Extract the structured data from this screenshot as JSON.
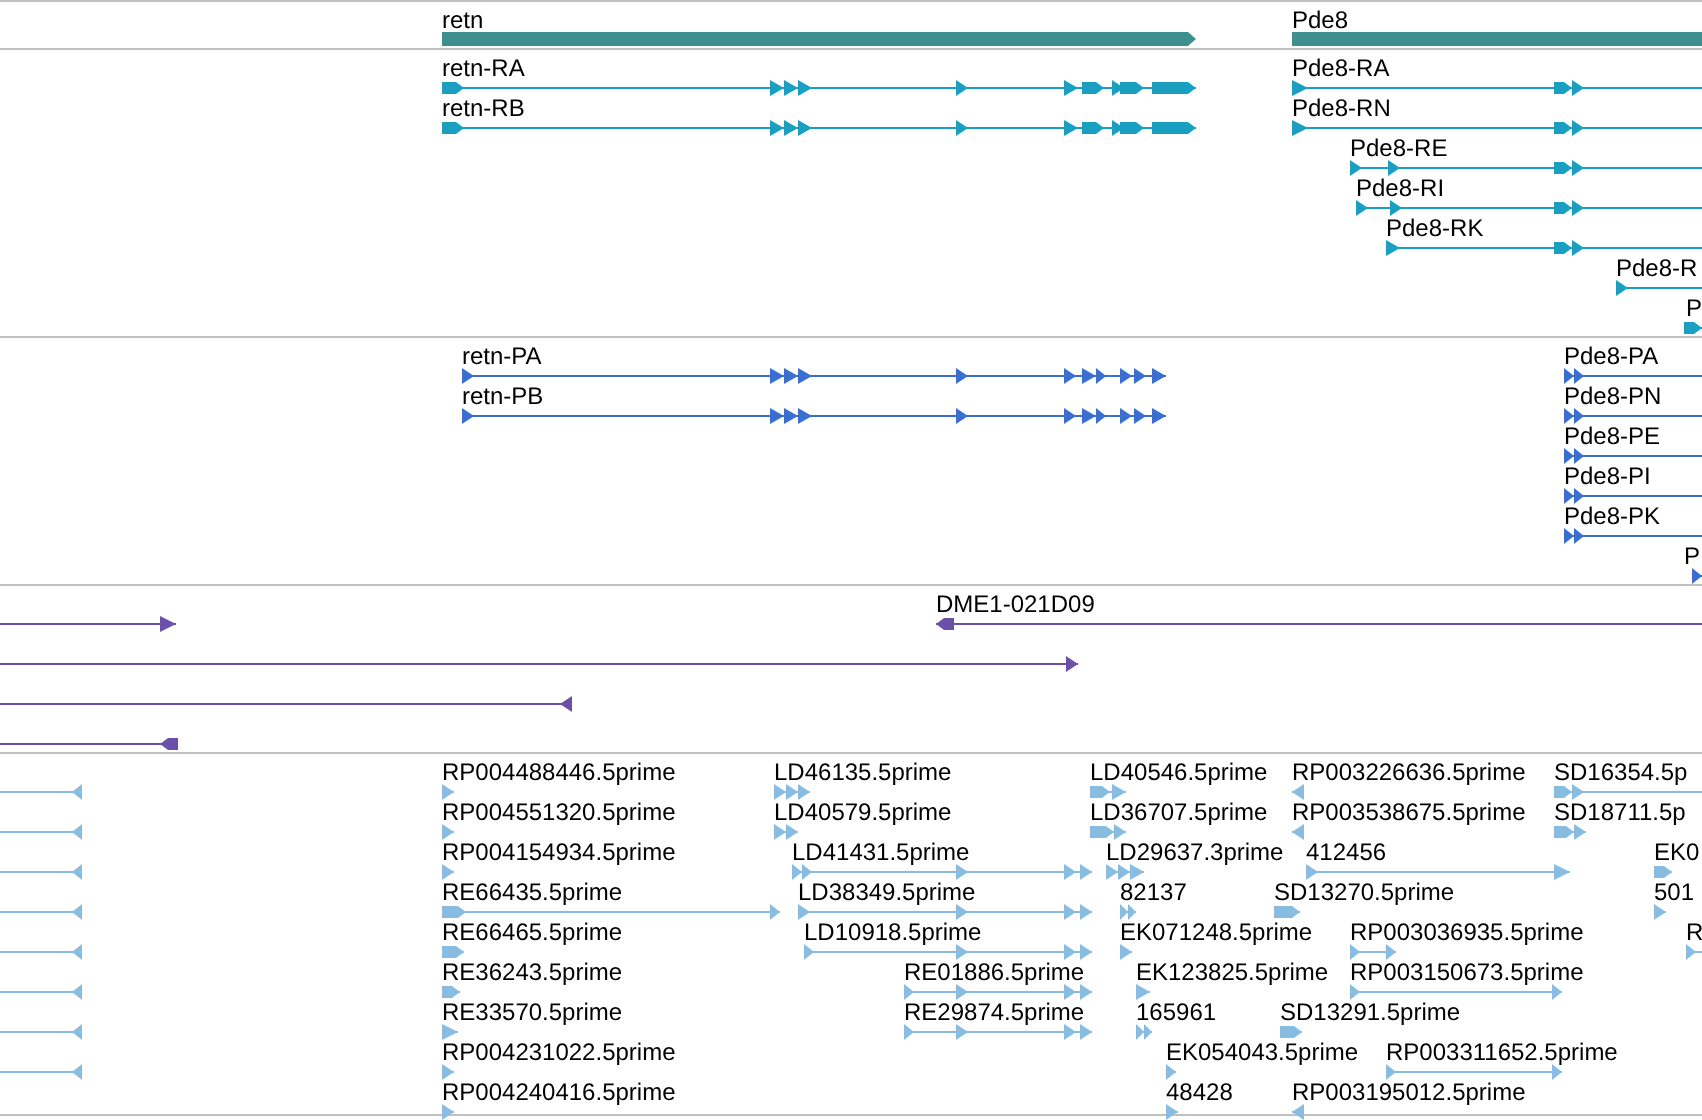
{
  "tracks": [
    {
      "kind": "gene",
      "color": "#3f8f8f",
      "features": [
        {
          "label": "retn",
          "reverse": false
        },
        {
          "label": "Pde8",
          "reverse": false
        }
      ]
    },
    {
      "kind": "transcript",
      "color": "#1a9fc0",
      "features": [
        {
          "label": "retn-RA",
          "reverse": false
        },
        {
          "label": "retn-RB",
          "reverse": false
        },
        {
          "label": "Pde8-RA",
          "reverse": false
        },
        {
          "label": "Pde8-RN",
          "reverse": false
        },
        {
          "label": "Pde8-RE",
          "reverse": false
        },
        {
          "label": "Pde8-RI",
          "reverse": false
        },
        {
          "label": "Pde8-RK",
          "reverse": false
        },
        {
          "label": "Pde8-R",
          "reverse": false
        },
        {
          "label": "P",
          "reverse": false
        }
      ]
    },
    {
      "kind": "protein",
      "color": "#3a6fd0",
      "features": [
        {
          "label": "retn-PA",
          "reverse": false
        },
        {
          "label": "retn-PB",
          "reverse": false
        },
        {
          "label": "Pde8-PA",
          "reverse": false
        },
        {
          "label": "Pde8-PN",
          "reverse": false
        },
        {
          "label": "Pde8-PE",
          "reverse": false
        },
        {
          "label": "Pde8-PI",
          "reverse": false
        },
        {
          "label": "Pde8-PK",
          "reverse": false
        },
        {
          "label": "P",
          "reverse": false
        }
      ]
    },
    {
      "kind": "clone",
      "color": "#6a50a8",
      "features": [
        {
          "reverse": false
        },
        {
          "label": "DME1-021D09",
          "reverse": true
        },
        {
          "reverse": false
        },
        {
          "reverse": true
        },
        {
          "reverse": true
        }
      ]
    },
    {
      "kind": "est",
      "color": "#88bce0",
      "features": [
        {
          "reverse": true
        },
        {
          "reverse": true
        },
        {
          "reverse": true
        },
        {
          "reverse": true
        },
        {
          "reverse": true
        },
        {
          "reverse": true
        },
        {
          "reverse": true
        },
        {
          "reverse": true
        },
        {
          "label": "RP004488446.5prime",
          "reverse": false
        },
        {
          "label": "LD46135.5prime",
          "reverse": false
        },
        {
          "label": "LD40546.5prime",
          "reverse": false
        },
        {
          "label": "RP003226636.5prime",
          "reverse": true
        },
        {
          "label": "SD16354.5p",
          "reverse": false
        },
        {
          "label": "RP004551320.5prime",
          "reverse": false
        },
        {
          "label": "LD40579.5prime",
          "reverse": false
        },
        {
          "label": "LD36707.5prime",
          "reverse": false
        },
        {
          "label": "RP003538675.5prime",
          "reverse": true
        },
        {
          "label": "SD18711.5p",
          "reverse": false
        },
        {
          "label": "RP004154934.5prime",
          "reverse": false
        },
        {
          "label": "LD41431.5prime",
          "reverse": false
        },
        {
          "label": "LD29637.3prime",
          "reverse": false
        },
        {
          "label": "412456",
          "reverse": false
        },
        {
          "label": "EK0",
          "reverse": false
        },
        {
          "label": "RE66435.5prime",
          "reverse": false
        },
        {
          "label": "LD38349.5prime",
          "reverse": false
        },
        {
          "label": "82137",
          "reverse": false
        },
        {
          "label": "SD13270.5prime",
          "reverse": false
        },
        {
          "label": "501",
          "reverse": false
        },
        {
          "label": "RE66465.5prime",
          "reverse": false
        },
        {
          "label": "LD10918.5prime",
          "reverse": false
        },
        {
          "label": "EK071248.5prime",
          "reverse": false
        },
        {
          "label": "RP003036935.5prime",
          "reverse": false
        },
        {
          "label": "R",
          "reverse": false
        },
        {
          "label": "RE36243.5prime",
          "reverse": false
        },
        {
          "label": "RE01886.5prime",
          "reverse": false
        },
        {
          "label": "EK123825.5prime",
          "reverse": false
        },
        {
          "label": "RP003150673.5prime",
          "reverse": false
        },
        {
          "label": "RE33570.5prime",
          "reverse": false
        },
        {
          "label": "RE29874.5prime",
          "reverse": false
        },
        {
          "label": "165961",
          "reverse": false
        },
        {
          "label": "SD13291.5prime",
          "reverse": false
        },
        {
          "label": "RP004231022.5prime",
          "reverse": false
        },
        {
          "label": "EK054043.5prime",
          "reverse": false
        },
        {
          "label": "RP003311652.5prime",
          "reverse": false
        },
        {
          "label": "RP004240416.5prime",
          "reverse": false
        },
        {
          "label": "48428",
          "reverse": false
        },
        {
          "label": "RP003195012.5prime",
          "reverse": true
        }
      ]
    }
  ]
}
